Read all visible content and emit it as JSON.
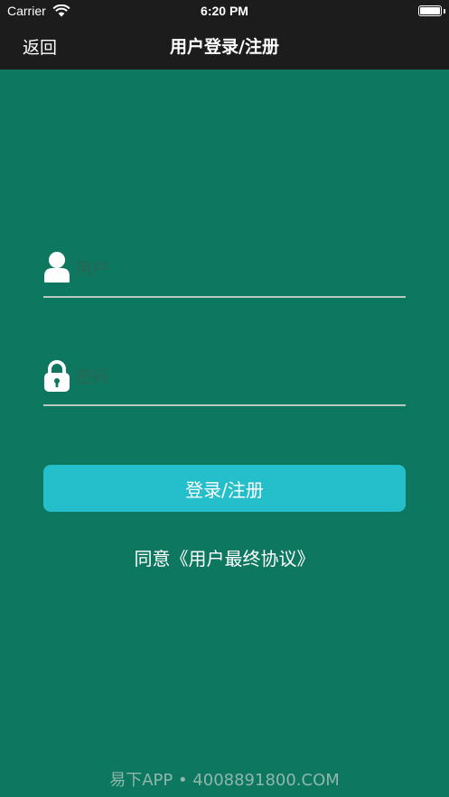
{
  "status_bar": {
    "carrier": "Carrier",
    "time": "6:20 PM"
  },
  "nav": {
    "back_label": "返回",
    "title": "用户登录/注册"
  },
  "form": {
    "username_placeholder": "用户",
    "password_placeholder": "密码",
    "submit_label": "登录/注册"
  },
  "agreement": "同意《用户最终协议》",
  "watermark": "易下APP • 4008891800.COM",
  "colors": {
    "background": "#0e775f",
    "nav_bar": "#1c1c1c",
    "button": "#25bfcb",
    "text": "#ffffff"
  },
  "icons": {
    "username": "user-icon",
    "password": "lock-icon",
    "signal": "wifi-icon",
    "battery": "battery-icon"
  }
}
